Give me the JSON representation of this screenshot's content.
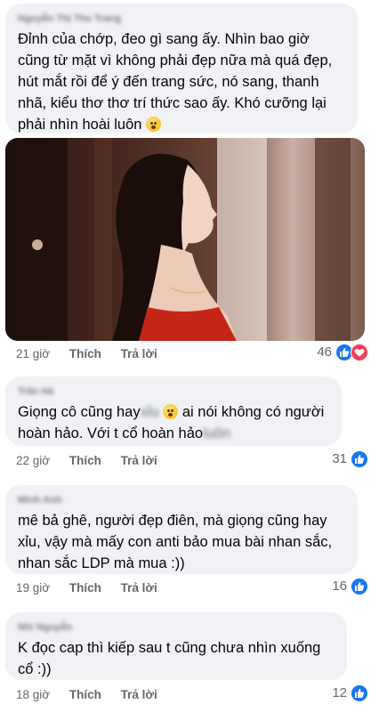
{
  "comments": [
    {
      "author": "Nguyễn Thị Thu Trang",
      "text": "Đỉnh của chớp, đeo gì sang ấy. Nhìn bao giờ cũng từ mặt vì không phải đẹp nữa mà quá đẹp, hút mắt rồi để ý đến trang sức, nó sang, thanh nhã, kiểu thơ thơ trí thức sao ấy. Khó cưỡng lại phải nhìn hoài luôn",
      "emoji": "hushed-face-emoji",
      "time": "21 giờ",
      "like_label": "Thích",
      "reply_label": "Trả lời",
      "reaction_count": "46",
      "reactions": [
        "like",
        "love"
      ]
    },
    {
      "author": "Trần Hà",
      "text_before": "Giọng cô cũng hay",
      "blurred_1": "xỉu",
      "text_middle": "ai nói không có người hoàn hảo. Với t cổ hoàn hảo",
      "blurred_2": "luôn",
      "emoji": "pleading-face-emoji",
      "time": "22 giờ",
      "like_label": "Thích",
      "reply_label": "Trả lời",
      "reaction_count": "31",
      "reactions": [
        "like"
      ]
    },
    {
      "author": "Minh Anh",
      "text": "mê bả ghê, người đẹp điên, mà giọng cũng hay xỉu, vậy mà mấy con anti bảo mua bài nhan sắc, nhan sắc LDP mà mua :))",
      "time": "19 giờ",
      "like_label": "Thích",
      "reply_label": "Trả lời",
      "reaction_count": "16",
      "reactions": [
        "like"
      ]
    },
    {
      "author": "Nhi Nguyễn",
      "text": "K đọc cap thì kiếp sau t cũng chưa nhìn xuống cổ :))",
      "time": "18 giờ",
      "like_label": "Thích",
      "reply_label": "Trả lời",
      "reaction_count": "12",
      "reactions": [
        "like"
      ]
    }
  ],
  "colors": {
    "bubble_bg": "#f0f2f5",
    "text": "#050505",
    "meta": "#65676b",
    "like_blue": "#1877f2",
    "love_red": "#f33e58"
  }
}
